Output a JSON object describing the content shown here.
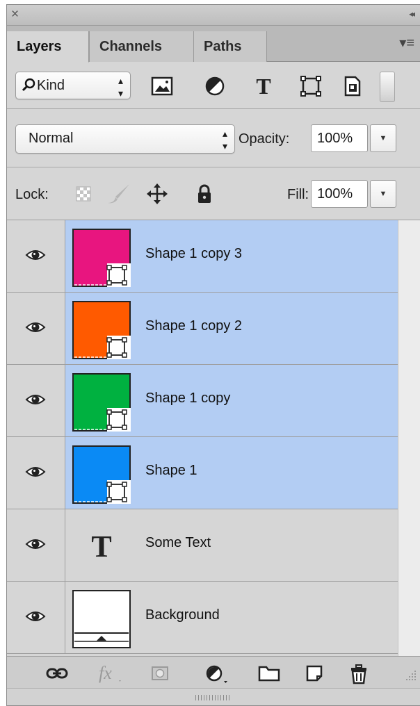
{
  "panel": {
    "close_glyph": "×",
    "collapse_glyph": "◂◂",
    "menu_glyph": "▾≡"
  },
  "tabs": [
    {
      "label": "Layers",
      "active": true
    },
    {
      "label": "Channels",
      "active": false
    },
    {
      "label": "Paths",
      "active": false
    }
  ],
  "filter": {
    "kind_label": "Kind",
    "icons": [
      "pixel-layer-filter-icon",
      "adjustment-layer-filter-icon",
      "type-layer-filter-icon",
      "shape-layer-filter-icon",
      "smart-object-filter-icon"
    ]
  },
  "blend": {
    "mode": "Normal",
    "opacity_label": "Opacity:",
    "opacity_value": "100%"
  },
  "lock": {
    "label": "Lock:",
    "fill_label": "Fill:",
    "fill_value": "100%",
    "icons": [
      "lock-transparent-pixels-icon",
      "lock-image-pixels-icon",
      "lock-position-icon",
      "lock-all-icon"
    ]
  },
  "layers": [
    {
      "name": "Shape 1 copy 3",
      "type": "shape",
      "color": "#e8157f",
      "selected": true,
      "visible": true
    },
    {
      "name": "Shape 1 copy 2",
      "type": "shape",
      "color": "#ff5a00",
      "selected": true,
      "visible": true
    },
    {
      "name": "Shape 1 copy",
      "type": "shape",
      "color": "#00b140",
      "selected": true,
      "visible": true
    },
    {
      "name": "Shape 1",
      "type": "shape",
      "color": "#0a8af5",
      "selected": true,
      "visible": true
    },
    {
      "name": "Some Text",
      "type": "text",
      "selected": false,
      "visible": true
    },
    {
      "name": "Background",
      "type": "background",
      "selected": false,
      "visible": true
    }
  ],
  "bottom_toolbar": {
    "icons": [
      "link-layers-icon",
      "layer-style-fx-icon",
      "add-mask-icon",
      "new-adjustment-layer-icon",
      "new-group-icon",
      "new-layer-icon",
      "delete-layer-icon"
    ]
  }
}
